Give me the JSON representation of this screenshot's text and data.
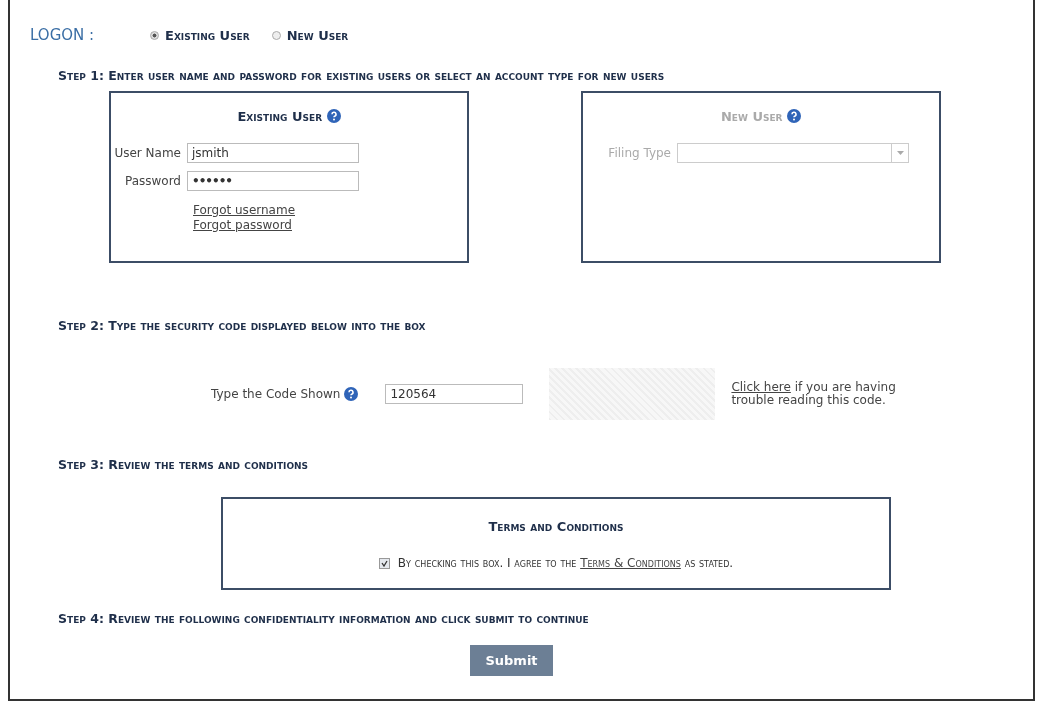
{
  "logon": {
    "label": "LOGON :",
    "options": [
      {
        "label": "Existing User",
        "selected": true
      },
      {
        "label": "New User",
        "selected": false
      }
    ]
  },
  "step1": {
    "heading": "Step 1: Enter user name and password for existing users or select an account type for new users",
    "existing_user": {
      "title": "Existing User",
      "disabled": false,
      "fields": [
        {
          "label": "User Name",
          "value": "jsmith",
          "kind": "text"
        },
        {
          "label": "Password",
          "value": "••••••",
          "kind": "password"
        }
      ],
      "links": [
        "Forgot username",
        "Forgot password"
      ]
    },
    "new_user": {
      "title": "New User",
      "disabled": true,
      "filing_type_label": "Filing Type"
    }
  },
  "step2": {
    "heading": "Step 2: Type the security code displayed below into the box",
    "code_label": "Type the Code Shown",
    "code_value": "120564",
    "help_link": "Click here",
    "help_text": " if you are having trouble reading this code."
  },
  "step3": {
    "heading": "Step 3: Review the terms and conditions",
    "terms_title": "Terms and Conditions",
    "agree_checked": true,
    "agree_text_before": "By checking this box. I agree to the ",
    "agree_link": "Terms & Conditions",
    "agree_text_after": " as stated."
  },
  "step4": {
    "heading": "Step 4: Review the following confidentiality information and click submit to continue",
    "submit": "Submit"
  }
}
